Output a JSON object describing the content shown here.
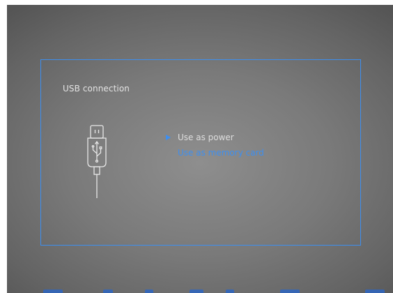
{
  "dialog": {
    "title": "USB connection",
    "icon": "usb-cable-icon",
    "options": [
      {
        "label": "Use as power",
        "state": "current"
      },
      {
        "label": "Use as memory card",
        "state": "highlighted"
      }
    ]
  },
  "colors": {
    "accent": "#3d8ff0",
    "text": "#e4e4e4",
    "background": "#7a7a7a"
  },
  "status_bar": {
    "icons": [
      "status-icon-1",
      "status-icon-2",
      "status-icon-3",
      "status-icon-4",
      "status-icon-5",
      "status-icon-6",
      "battery-icon"
    ]
  }
}
